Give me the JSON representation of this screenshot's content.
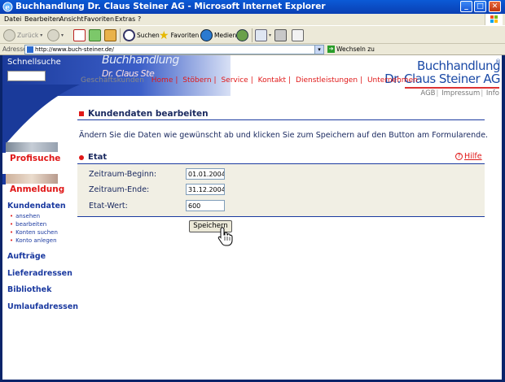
{
  "window": {
    "title": "Buchhandlung Dr. Claus Steiner AG - Microsoft Internet Explorer",
    "minimize": "_",
    "maximize": "□",
    "close": "✕"
  },
  "menubar": {
    "items": [
      "Datei",
      "Bearbeiten",
      "Ansicht",
      "Favoriten",
      "Extras",
      "?"
    ]
  },
  "toolbar": {
    "back": "Zurück",
    "search": "Suchen",
    "favorites": "Favoriten",
    "media": "Medien"
  },
  "addressbar": {
    "label": "Adresse",
    "url": "http://www.buch-steiner.de/",
    "go": "Wechseln zu"
  },
  "site": {
    "quicksearch_label": "Schnellsuche",
    "logo_small": "Buchhandlung",
    "logo_small2": "Dr. Claus Ste",
    "logo_line1": "Buchhandlung",
    "logo_line2": "Dr. Claus Steiner AG",
    "logo_reg": "®",
    "subnav": [
      "AGB",
      "Impressum",
      "Info"
    ],
    "mainnav_lead": "Geschäftskunden",
    "mainnav": [
      "Home",
      "Stöbern",
      "Service",
      "Kontakt",
      "Dienstleistungen",
      "Unternehmen"
    ]
  },
  "sidebar": {
    "profisuche": "Profisuche",
    "anmeldung": "Anmeldung",
    "kundendaten": "Kundendaten",
    "kundendaten_sub": [
      "ansehen",
      "bearbeiten",
      "Konten suchen",
      "Konto anlegen"
    ],
    "auftraege": "Aufträge",
    "lieferadressen": "Lieferadressen",
    "bibliothek": "Bibliothek",
    "umlaufadressen": "Umlaufadressen"
  },
  "main": {
    "heading": "Kundendaten bearbeiten",
    "intro": "Ändern Sie die Daten wie gewünscht ab und klicken Sie zum Speichern auf den Button am Formularende.",
    "section_title": "Etat",
    "help": "Hilfe",
    "fields": [
      {
        "label": "Zeitraum-Beginn:",
        "value": "01.01.2004"
      },
      {
        "label": "Zeitraum-Ende:",
        "value": "31.12.2004"
      },
      {
        "label": "Etat-Wert:",
        "value": "600"
      }
    ],
    "save": "Speichern"
  }
}
